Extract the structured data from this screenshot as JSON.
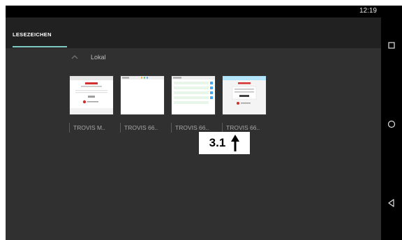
{
  "status_bar": {
    "time": "12:19"
  },
  "tabs": [
    {
      "label": "LESEZEICHEN",
      "active": true
    }
  ],
  "folder": {
    "label": "Lokal",
    "icon": "chevron-up-icon"
  },
  "bookmarks": [
    {
      "title": "TROVIS M..",
      "thumbnail": "login-page"
    },
    {
      "title": "TROVIS 66..",
      "thumbnail": "blank-page"
    },
    {
      "title": "TROVIS 66..",
      "thumbnail": "list-page"
    },
    {
      "title": "TROVIS 66..",
      "thumbnail": "form-page"
    }
  ],
  "annotation": {
    "label": "3.1",
    "icon": "arrow-up-icon"
  },
  "nav_bar": {
    "buttons": [
      "recents-icon",
      "home-icon",
      "back-icon"
    ]
  },
  "colors": {
    "background": "#303030",
    "appbar": "#212121",
    "accent": "#80cbc4",
    "brand_red": "#d32f2f"
  }
}
